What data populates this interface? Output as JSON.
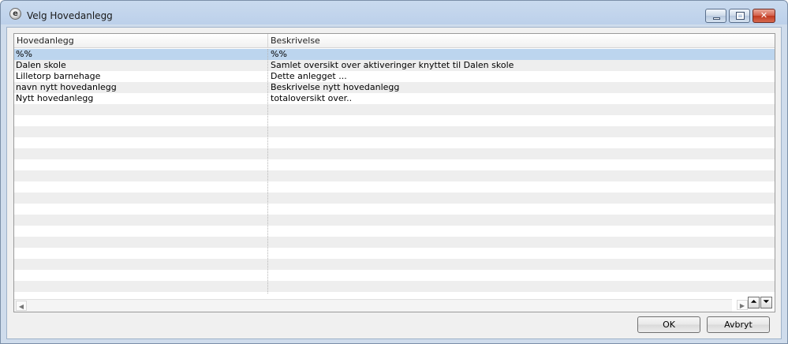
{
  "window": {
    "title": "Velg Hovedanlegg",
    "app_icon_glyph": "e",
    "close_glyph": "✕"
  },
  "grid": {
    "columns": [
      "Hovedanlegg",
      "Beskrivelse"
    ],
    "rows": [
      {
        "hovedanlegg": "%%",
        "beskrivelse": "%%",
        "selected": true
      },
      {
        "hovedanlegg": "Dalen skole",
        "beskrivelse": "Samlet oversikt over aktiveringer knyttet til Dalen skole"
      },
      {
        "hovedanlegg": "Lilletorp barnehage",
        "beskrivelse": "Dette anlegget ..."
      },
      {
        "hovedanlegg": "navn nytt hovedanlegg",
        "beskrivelse": "Beskrivelse nytt hovedanlegg"
      },
      {
        "hovedanlegg": "Nytt hovedanlegg",
        "beskrivelse": "totaloversikt over.."
      },
      {
        "hovedanlegg": "",
        "beskrivelse": ""
      },
      {
        "hovedanlegg": "",
        "beskrivelse": ""
      },
      {
        "hovedanlegg": "",
        "beskrivelse": ""
      },
      {
        "hovedanlegg": "",
        "beskrivelse": ""
      },
      {
        "hovedanlegg": "",
        "beskrivelse": ""
      },
      {
        "hovedanlegg": "",
        "beskrivelse": ""
      },
      {
        "hovedanlegg": "",
        "beskrivelse": ""
      },
      {
        "hovedanlegg": "",
        "beskrivelse": ""
      },
      {
        "hovedanlegg": "",
        "beskrivelse": ""
      },
      {
        "hovedanlegg": "",
        "beskrivelse": ""
      },
      {
        "hovedanlegg": "",
        "beskrivelse": ""
      },
      {
        "hovedanlegg": "",
        "beskrivelse": ""
      },
      {
        "hovedanlegg": "",
        "beskrivelse": ""
      },
      {
        "hovedanlegg": "",
        "beskrivelse": ""
      },
      {
        "hovedanlegg": "",
        "beskrivelse": ""
      },
      {
        "hovedanlegg": "",
        "beskrivelse": ""
      },
      {
        "hovedanlegg": "",
        "beskrivelse": ""
      }
    ],
    "scroll_left_glyph": "◀",
    "scroll_right_glyph": "▶",
    "nav_up_glyph": "⏶",
    "nav_down_glyph": "⏷"
  },
  "buttons": {
    "ok": "OK",
    "cancel": "Avbryt"
  },
  "colors": {
    "selected_row": "#bcd5ee",
    "title_bar": "#bcd0ea",
    "close_button": "#c0381f"
  }
}
